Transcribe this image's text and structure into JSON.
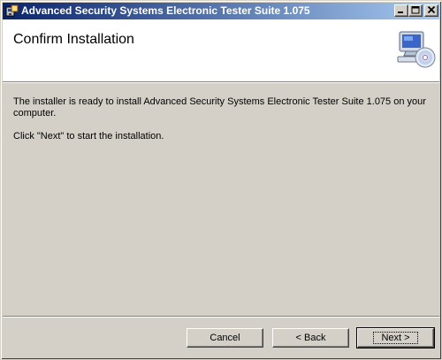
{
  "window": {
    "title": "Advanced Security Systems Electronic Tester Suite 1.075",
    "icon": "installer-app-icon",
    "controls": {
      "minimize": "minimize-icon",
      "maximize": "maximize-icon",
      "close": "close-icon"
    }
  },
  "header": {
    "title": "Confirm Installation",
    "icon": "computer-cd-icon"
  },
  "body": {
    "line1": "The installer is ready to install Advanced Security Systems Electronic Tester Suite 1.075 on your",
    "line2": "computer.",
    "line3": "Click \"Next\" to start the installation."
  },
  "buttons": {
    "cancel": "Cancel",
    "back": "< Back",
    "next": "Next >"
  }
}
